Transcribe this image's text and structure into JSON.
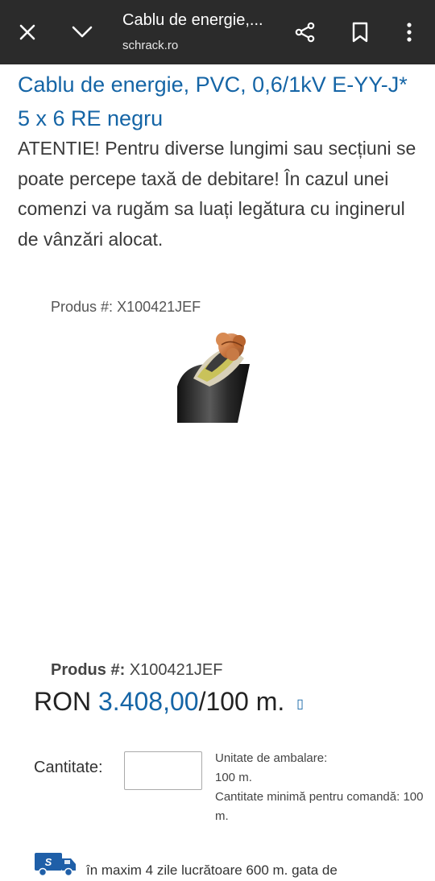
{
  "browser": {
    "page_title": "Cablu de energie,...",
    "domain": "schrack.ro"
  },
  "product": {
    "title": "Cablu de energie, PVC, 0,6/1kV E-YY-J* 5 x 6 RE negru",
    "notice": "ATENTIE! Pentru diverse lungimi sau secțiuni se poate percepe taxă de debitare! În cazul unei comenzi va rugăm sa luați legătura cu inginerul de vânzări alocat.",
    "product_no_label": "Produs #:",
    "product_no": "X100421JEF",
    "currency": "RON",
    "price_value": "3.408,00",
    "price_unit": "/100 m.",
    "quantity_label": "Cantitate:",
    "quantity_value": "",
    "packaging_label": "Unitate de ambalare:",
    "packaging_value": "100 m.",
    "min_order_label": "Cantitate minimă pentru comandă:",
    "min_order_value": "100 m.",
    "delivery_text": "în maxim 4 zile lucrătoare 600 m. gata de"
  },
  "colors": {
    "topbar": "#2b2b2b",
    "accent": "#1565a6"
  }
}
